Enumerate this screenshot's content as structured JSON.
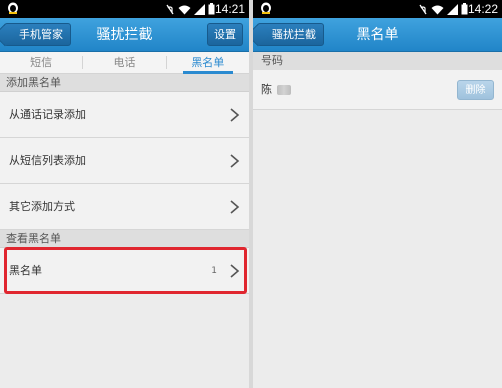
{
  "left": {
    "status_time": "14:21",
    "back_label": "手机管家",
    "title": "骚扰拦截",
    "settings_label": "设置",
    "tabs": [
      {
        "label": "短信"
      },
      {
        "label": "电话"
      },
      {
        "label": "黑名单"
      }
    ],
    "active_tab": "黑名单",
    "add_section": "添加黑名单",
    "add_items": [
      {
        "label": "从通话记录添加"
      },
      {
        "label": "从短信列表添加"
      },
      {
        "label": "其它添加方式"
      }
    ],
    "view_section": "查看黑名单",
    "view_item": {
      "label": "黑名单",
      "count": "1"
    },
    "highlight_color": "#e0262f"
  },
  "right": {
    "status_time": "14:22",
    "back_label": "骚扰拦截",
    "title": "黑名单",
    "header": "号码",
    "entry": {
      "name": "陈",
      "delete_label": "删除"
    }
  },
  "colors": {
    "titlebar": "#2a8ad0",
    "accent": "#2a8ad0"
  },
  "icons": [
    "qq-notification-icon",
    "mute-icon",
    "wifi-icon",
    "signal-icon",
    "battery-icon",
    "chevron-right-icon"
  ]
}
